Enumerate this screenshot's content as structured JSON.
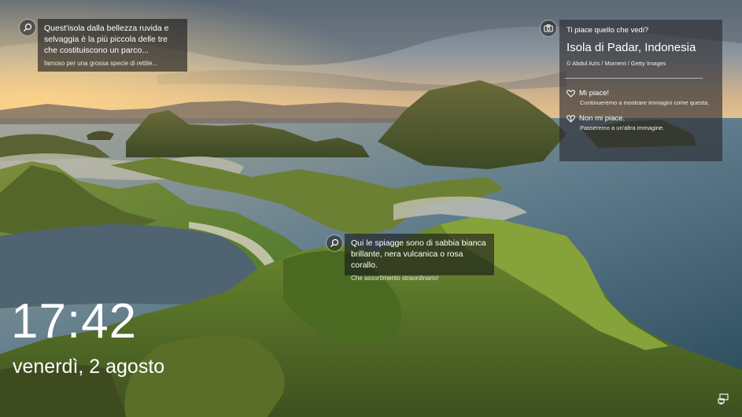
{
  "spotlight": {
    "tip_top_left": {
      "main": "Quest'isola dalla bellezza ruvida e selvaggia è la più piccola delle tre che costituiscono un parco...",
      "sub": "famoso per una grossa specie di rettile..."
    },
    "tip_center": {
      "main": "Qui le spiagge sono di sabbia bianca brillante, nera vulcanica o rosa corallo.",
      "sub": "Che assortimento straordinario!"
    }
  },
  "panel": {
    "question": "Ti piace quello che vedi?",
    "location": "Isola di Padar, Indonesia",
    "credit": "© Abdul Azis / Moment / Getty Images",
    "like": {
      "label": "Mi piace!",
      "desc": "Continueremo a mostrare immagini come questa."
    },
    "dislike": {
      "label": "Non mi piace.",
      "desc": "Passeremo a un'altra immagine."
    }
  },
  "lockscreen": {
    "time": "17:42",
    "date": "venerdì, 2 agosto"
  }
}
